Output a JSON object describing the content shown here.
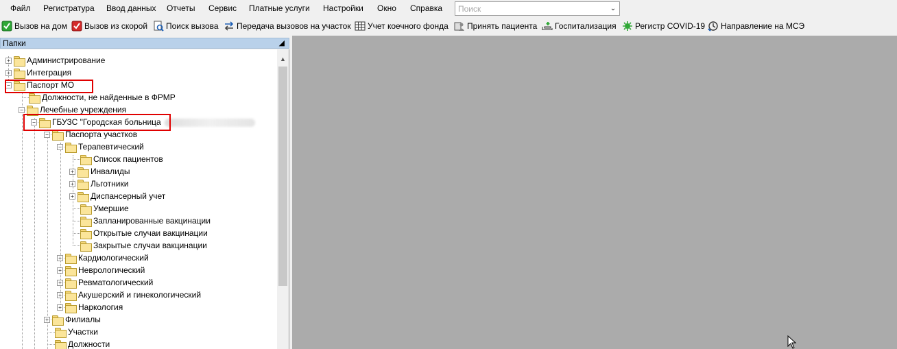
{
  "menu": [
    "Файл",
    "Регистратура",
    "Ввод данных",
    "Отчеты",
    "Сервис",
    "Платные услуги",
    "Настройки",
    "Окно",
    "Справка"
  ],
  "search": {
    "placeholder": "Поиск"
  },
  "toolbar": [
    {
      "label": "Вызов на дом",
      "icon": "green-check-icon"
    },
    {
      "label": "Вызов из скорой",
      "icon": "red-check-icon"
    },
    {
      "label": "Поиск вызова",
      "icon": "search-document-icon"
    },
    {
      "label": "Передача вызовов на участок",
      "icon": "transfer-arrows-icon"
    },
    {
      "label": "Учет коечного фонда",
      "icon": "bed-grid-icon"
    },
    {
      "label": "Принять пациента",
      "icon": "accept-patient-icon"
    },
    {
      "label": "Госпитализация",
      "icon": "hospitalization-icon"
    },
    {
      "label": "Регистр COVID-19",
      "icon": "virus-icon"
    },
    {
      "label": "Направление на МСЭ",
      "icon": "referral-icon"
    }
  ],
  "panel": {
    "title": "Папки",
    "pin": "ᵩ"
  },
  "tree": [
    {
      "label": "Администрирование",
      "level": 0,
      "expander": "+"
    },
    {
      "label": "Интеграция",
      "level": 0,
      "expander": "+"
    },
    {
      "label": "Паспорт МО",
      "level": 0,
      "expander": "−"
    },
    {
      "label": "Должности, не найденные в ФРМР",
      "level": 1,
      "expander": ""
    },
    {
      "label": "Лечебные учреждения",
      "level": 1,
      "expander": "−"
    },
    {
      "label": "ГБУЗС \"Городская больница",
      "level": 2,
      "expander": "−"
    },
    {
      "label": "Паспорта участков",
      "level": 3,
      "expander": "−"
    },
    {
      "label": "Терапевтический",
      "level": 4,
      "expander": "−"
    },
    {
      "label": "Список пациентов",
      "level": 5,
      "expander": ""
    },
    {
      "label": "Инвалиды",
      "level": 5,
      "expander": "+"
    },
    {
      "label": "Льготники",
      "level": 5,
      "expander": "+"
    },
    {
      "label": "Диспансерный учет",
      "level": 5,
      "expander": "+"
    },
    {
      "label": "Умершие",
      "level": 5,
      "expander": ""
    },
    {
      "label": "Запланированные вакцинации",
      "level": 5,
      "expander": ""
    },
    {
      "label": "Открытые случаи вакцинации",
      "level": 5,
      "expander": ""
    },
    {
      "label": "Закрытые случаи вакцинации",
      "level": 5,
      "expander": ""
    },
    {
      "label": "Кардиологический",
      "level": 4,
      "expander": "+"
    },
    {
      "label": "Неврологический",
      "level": 4,
      "expander": "+"
    },
    {
      "label": "Ревматологический",
      "level": 4,
      "expander": "+"
    },
    {
      "label": "Акушерский и гинекологический",
      "level": 4,
      "expander": "+"
    },
    {
      "label": "Наркология",
      "level": 4,
      "expander": "+"
    },
    {
      "label": "Филиалы",
      "level": 3,
      "expander": "+"
    },
    {
      "label": "Участки",
      "level": 3,
      "expander": ""
    },
    {
      "label": "Должности",
      "level": 3,
      "expander": ""
    }
  ],
  "colors": {
    "highlight": "#e00000",
    "workspace": "#ababab",
    "panel_header": "#b9d1ea"
  }
}
